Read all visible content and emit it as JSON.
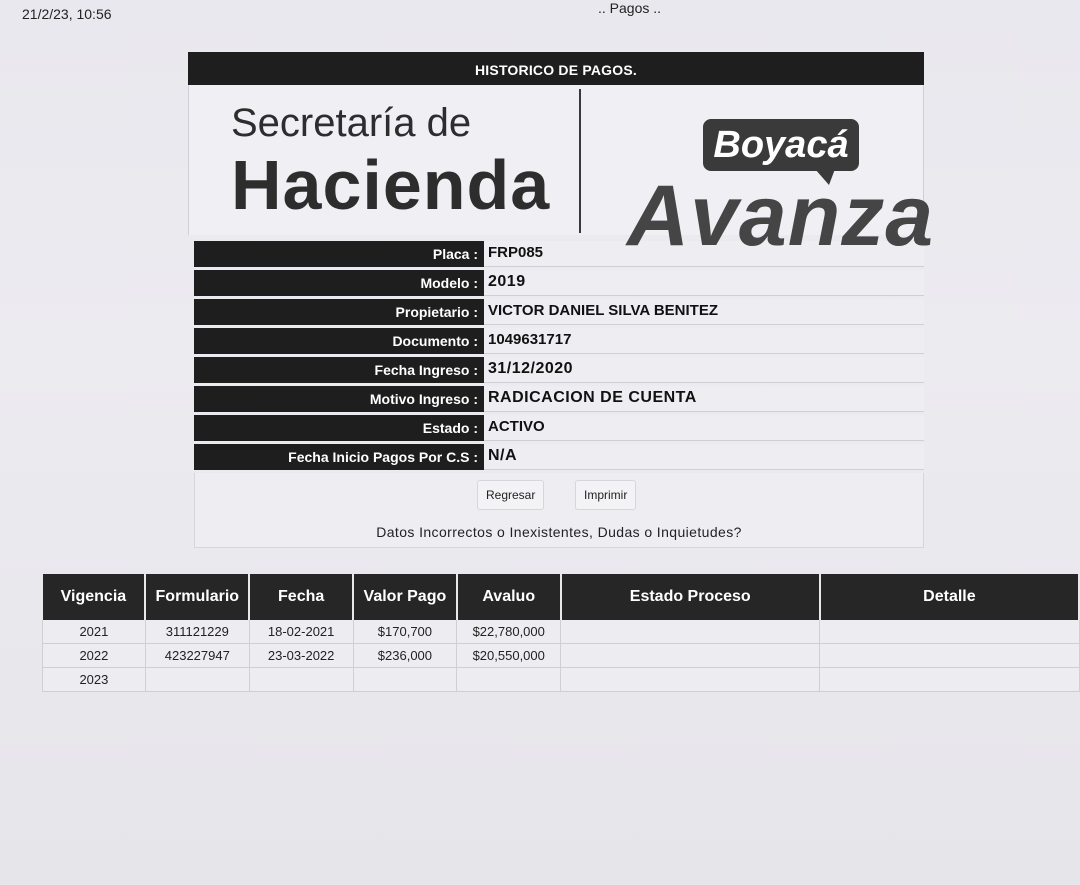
{
  "page": {
    "timestamp": "21/2/23, 10:56",
    "heading": ".. Pagos .."
  },
  "panel": {
    "title": "HISTORICO DE PAGOS.",
    "logo_left_line1": "Secretaría de",
    "logo_left_line2": "Hacienda",
    "logo_right_badge": "Boyacá",
    "logo_right_word": "Avanza"
  },
  "vehicle": [
    {
      "label": "Placa :",
      "value": "FRP085"
    },
    {
      "label": "Modelo :",
      "value": "2019"
    },
    {
      "label": "Propietario :",
      "value": "VICTOR DANIEL SILVA BENITEZ"
    },
    {
      "label": "Documento :",
      "value": "1049631717"
    },
    {
      "label": "Fecha Ingreso :",
      "value": "31/12/2020"
    },
    {
      "label": "Motivo Ingreso :",
      "value": "RADICACION DE CUENTA"
    },
    {
      "label": "Estado :",
      "value": "ACTIVO"
    },
    {
      "label": "Fecha Inicio Pagos Por C.S :",
      "value": "N/A"
    }
  ],
  "buttons": {
    "back": "Regresar",
    "print": "Imprimir"
  },
  "help_text": "Datos Incorrectos o Inexistentes, Dudas o Inquietudes?",
  "payments": {
    "columns": [
      "Vigencia",
      "Formulario",
      "Fecha",
      "Valor Pago",
      "Avaluo",
      "Estado Proceso",
      "Detalle"
    ],
    "rows": [
      [
        "2021",
        "311121229",
        "18-02-2021",
        "$170,700",
        "$22,780,000",
        "",
        ""
      ],
      [
        "2022",
        "423227947",
        "23-03-2022",
        "$236,000",
        "$20,550,000",
        "",
        ""
      ],
      [
        "2023",
        "",
        "",
        "",
        "",
        "",
        ""
      ]
    ]
  }
}
